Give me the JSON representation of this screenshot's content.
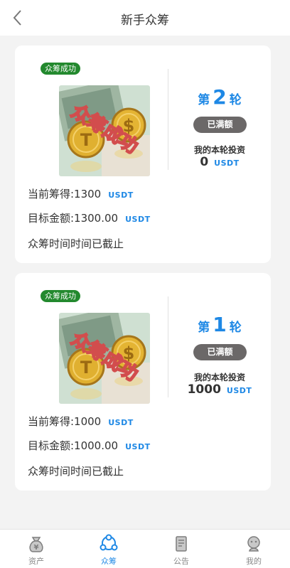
{
  "header": {
    "title": "新手众筹",
    "back_icon": "chevron-left-icon"
  },
  "projects": [
    {
      "badge": "众筹成功",
      "image_stamp": "众筹成功",
      "round_prefix": "第",
      "round_number": "2",
      "round_suffix": "轮",
      "status": "已满额",
      "my_investment_label": "我的本轮投资",
      "my_investment": "0",
      "my_investment_unit": "USDT",
      "raised_label": "当前筹得:1300",
      "raised_unit": "USDT",
      "target_label": "目标金额:1300.00",
      "target_unit": "USDT",
      "deadline": "众筹时间时间已截止"
    },
    {
      "badge": "众筹成功",
      "image_stamp": "众筹成功",
      "round_prefix": "第",
      "round_number": "1",
      "round_suffix": "轮",
      "status": "已满额",
      "my_investment_label": "我的本轮投资",
      "my_investment": "1000",
      "my_investment_unit": "USDT",
      "raised_label": "当前筹得:1000",
      "raised_unit": "USDT",
      "target_label": "目标金额:1000.00",
      "target_unit": "USDT",
      "deadline": "众筹时间时间已截止"
    }
  ],
  "tabbar": [
    {
      "label": "资产",
      "icon": "money-bag-icon",
      "active": false
    },
    {
      "label": "众筹",
      "icon": "crowdfund-icon",
      "active": true
    },
    {
      "label": "公告",
      "icon": "notice-icon",
      "active": false
    },
    {
      "label": "我的",
      "icon": "profile-icon",
      "active": false
    }
  ],
  "colors": {
    "accent": "#1e88e5",
    "success": "#23892e",
    "pill": "#6b6868",
    "background": "#f3f3f3"
  }
}
